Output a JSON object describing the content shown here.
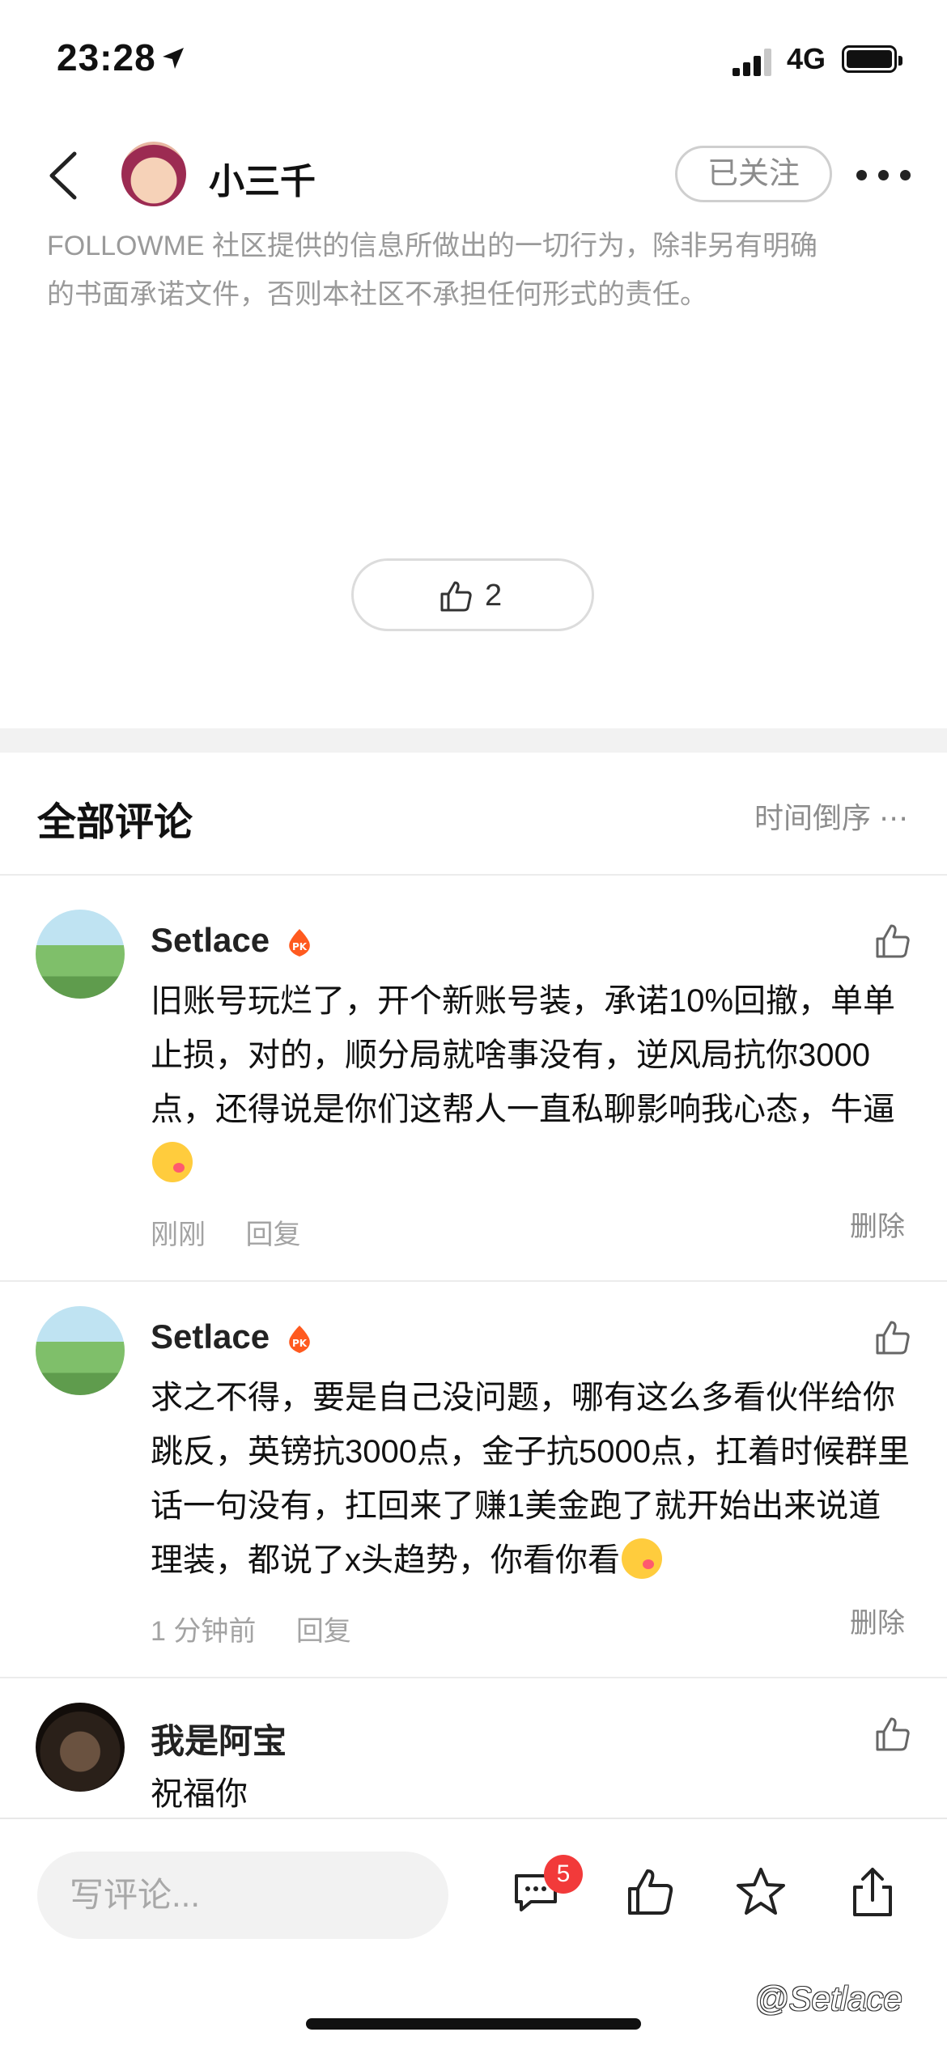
{
  "status_bar": {
    "time": "23:28",
    "network": "4G"
  },
  "header": {
    "username": "小三千",
    "follow_label": "已关注"
  },
  "disclaimer": {
    "line1": "FOLLOWME 社区提供的信息所做出的一切行为，除非另有明确",
    "line2": "的书面承诺文件，否则本社区不承担任何形式的责任。"
  },
  "post": {
    "like_count": "2"
  },
  "comments_section": {
    "title": "全部评论",
    "sort_label": "时间倒序 ⋯"
  },
  "comments": [
    {
      "author": "Setlace",
      "badge": "PK",
      "text": "旧账号玩烂了，开个新账号装，承诺10%回撤，单单止损，对的，顺分局就啥事没有，逆风局抗你3000点，还得说是你们这帮人一直私聊影响我心态，牛逼",
      "time": "刚刚",
      "reply_label": "回复",
      "delete_label": "删除"
    },
    {
      "author": "Setlace",
      "badge": "PK",
      "text": "求之不得，要是自己没问题，哪有这么多看伙伴给你跳反，英镑抗3000点，金子抗5000点，扛着时候群里话一句没有，扛回来了赚1美金跑了就开始出来说道理装，都说了x头趋势，你看你看",
      "time": "1 分钟前",
      "reply_label": "回复",
      "delete_label": "删除"
    },
    {
      "author": "我是阿宝",
      "text": "祝福你"
    }
  ],
  "bottom_bar": {
    "input_placeholder": "写评论...",
    "comment_count": "5"
  },
  "watermark": "@Setlace",
  "colors": {
    "accent_badge": "#ff5a1f",
    "unread_badge": "#f23a3a"
  }
}
